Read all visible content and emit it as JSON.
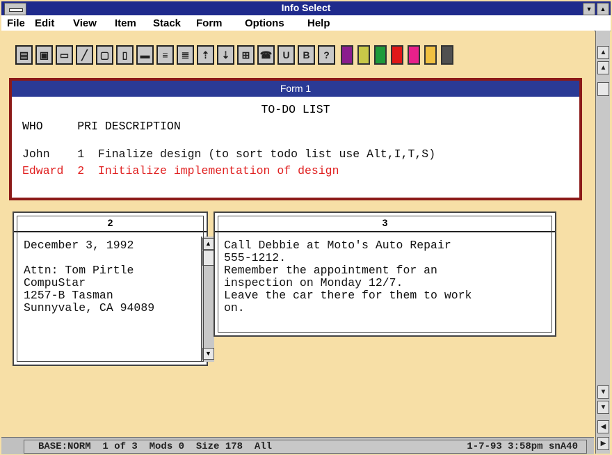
{
  "window": {
    "title": "Info Select"
  },
  "menu": [
    "File",
    "Edit",
    "View",
    "Item",
    "Stack",
    "Form",
    "Options",
    "Help"
  ],
  "toolbar": {
    "buttons": [
      "stack-icon",
      "save-icon",
      "note-icon",
      "pencil-icon",
      "copy-icon",
      "page-icon",
      "print-icon",
      "import-icon",
      "export-icon",
      "sort-up-icon",
      "sort-down-icon",
      "link-icon",
      "phone-icon",
      "underline-icon",
      "bold-icon",
      "help-icon"
    ],
    "button_glyphs": [
      "▤",
      "▣",
      "▭",
      "╱",
      "▢",
      "▯",
      "▬",
      "≡",
      "≣",
      "⇡",
      "⇣",
      "⊞",
      "☎",
      "U",
      "B",
      "?"
    ],
    "colors": [
      "#8a1d8e",
      "#c8c848",
      "#1e9a3a",
      "#e01818",
      "#e8208a",
      "#f0c040",
      "#505050"
    ]
  },
  "form1": {
    "title": "Form 1",
    "list_title": "TO-DO LIST",
    "header": "WHO     PRI DESCRIPTION",
    "rows": [
      {
        "text": "John    1  Finalize design (to sort todo list use Alt,I,T,S)",
        "color": "#111111"
      },
      {
        "text": "Edward  2  Initialize implementation of design",
        "color": "#e02020"
      }
    ]
  },
  "note2": {
    "title": "2",
    "body": "December 3, 1992\n\nAttn: Tom Pirtle\nCompuStar\n1257-B Tasman\nSunnyvale, CA 94089"
  },
  "note3": {
    "title": "3",
    "body": "Call Debbie at Moto's Auto Repair\n555-1212.\nRemember the appointment for an\ninspection on Monday 12/7.\nLeave the car there for them to work\non."
  },
  "status": {
    "left": "BASE:NORM  1 of 3  Mods 0  Size 178  All",
    "right": "1-7-93 3:58pm snA40"
  }
}
